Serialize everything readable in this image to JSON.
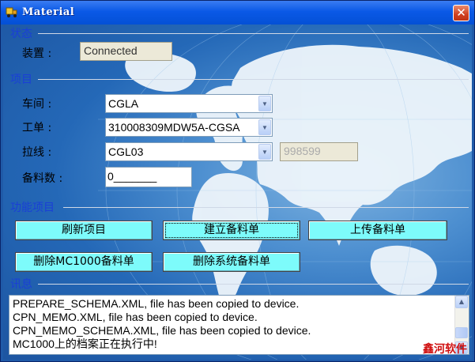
{
  "window": {
    "title": "Material",
    "close_glyph": "✕"
  },
  "status_section": {
    "label": "状态",
    "device_label": "装置 :",
    "device_value": "Connected"
  },
  "project_section": {
    "label": "项目",
    "workshop_label": "车间 :",
    "workshop_value": "CGLA",
    "work_order_label": "工单 :",
    "work_order_value": "310008309MDW5A-CGSA",
    "line_label": "拉线 :",
    "line_value": "CGL03",
    "line_code_value": "998599",
    "count_label": "备料数 :",
    "count_value": "0_______"
  },
  "function_section": {
    "label": "功能项目",
    "refresh_button": "刷新项目",
    "create_button": "建立备料单",
    "upload_button": "上传备料单",
    "delete_mc_button": "删除MC1000备料单",
    "delete_system_button": "删除系统备料单"
  },
  "message_section": {
    "label": "讯息",
    "lines": [
      "PREPARE_SCHEMA.XML, file has been copied to device.",
      "CPN_MEMO.XML, file has been copied to device.",
      "CPN_MEMO_SCHEMA.XML, file has been copied to device.",
      "MC1000上的档案正在执行中!"
    ]
  },
  "watermark": "鑫河软件",
  "icons": {
    "app": "truck-icon",
    "close": "close-icon",
    "dropdown": "chevron-down-icon",
    "scroll_up": "scroll-up-icon",
    "scroll_down": "scroll-down-icon"
  },
  "colors": {
    "title_bar": "#0450d6",
    "section_label": "#1a3fd6",
    "button_face": "#7dfbfb",
    "close_button": "#d0401f",
    "background_blue": "#2468b7",
    "watermark": "#d01010"
  }
}
